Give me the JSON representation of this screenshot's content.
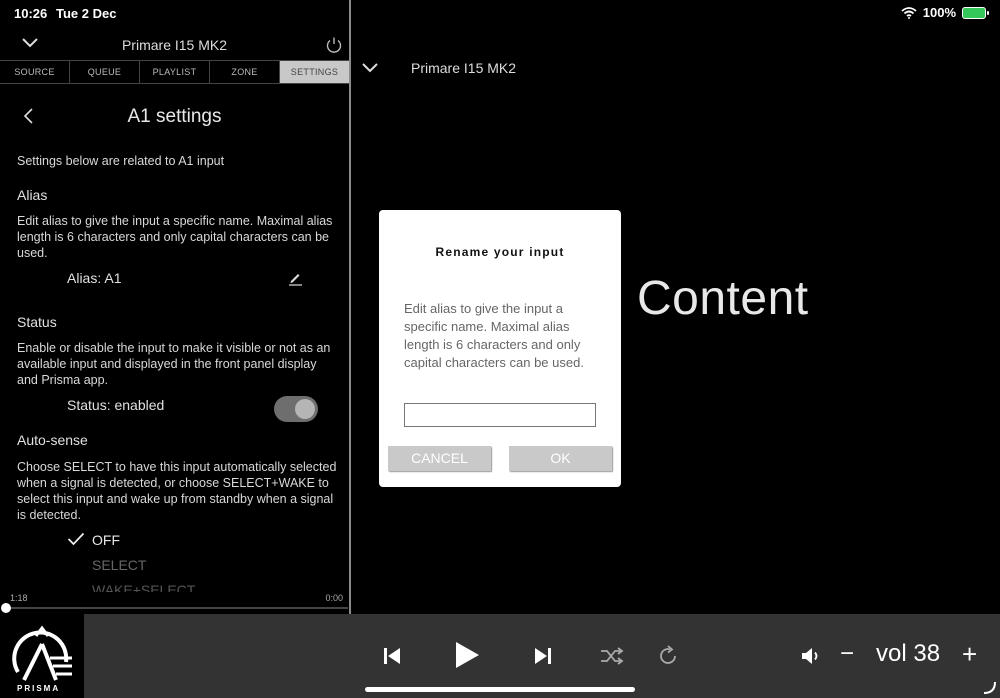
{
  "status_bar": {
    "time": "10:26",
    "date": "Tue 2 Dec",
    "battery": "100%"
  },
  "left_panel": {
    "device_title": "Primare I15 MK2",
    "tabs": [
      {
        "label": "SOURCE"
      },
      {
        "label": "QUEUE"
      },
      {
        "label": "PLAYLIST"
      },
      {
        "label": "ZONE"
      },
      {
        "label": "SETTINGS",
        "active": true
      }
    ],
    "page_title": "A1 settings",
    "intro": "Settings below are related to A1 input",
    "alias": {
      "heading": "Alias",
      "description": "Edit alias to give the input a specific name. Maximal alias length is 6 characters and only capital characters can be used.",
      "value": "Alias:  A1"
    },
    "status": {
      "heading": "Status",
      "description": "Enable or disable the input to make it visible or not as an available input and displayed in the front panel display and Prisma app.",
      "value": "Status:  enabled",
      "toggle_on": true
    },
    "autosense": {
      "heading": "Auto-sense",
      "description": "Choose SELECT to have this input automatically selected when a signal is detected, or choose SELECT+WAKE to select this input and wake up from standby when a signal is detected.",
      "options": [
        {
          "label": "OFF",
          "selected": true
        },
        {
          "label": "SELECT",
          "selected": false
        },
        {
          "label": "WAKE+SELECT",
          "selected": false
        }
      ]
    },
    "elapsed": "1:18",
    "remaining": "0:00"
  },
  "right_panel": {
    "device_title": "Primare I15 MK2",
    "content_label": "Content"
  },
  "dialog": {
    "title": "Rename your input",
    "body": "Edit alias to give the input a specific name. Maximal alias length is 6 characters and only capital characters can be used.",
    "input_value": "",
    "cancel_label": "CANCEL",
    "ok_label": "OK"
  },
  "player": {
    "brand": "PRISMA",
    "volume_minus": "−",
    "volume_label": "vol 38",
    "volume_plus": "+"
  },
  "colors": {
    "background": "#000000",
    "bottom_bar": "#333333",
    "active_tab": "#c8c8c8",
    "dialog_button": "#c9c9c9",
    "battery": "#34c759"
  }
}
